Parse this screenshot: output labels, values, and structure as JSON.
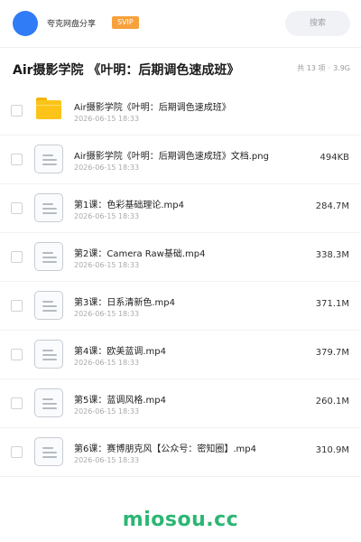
{
  "header": {
    "app_name": "夸克网盘分享",
    "badge": "SVIP",
    "search_label": "搜索"
  },
  "folder": {
    "title": "Air摄影学院 《叶明：后期调色速成班》",
    "count": "共 13 项",
    "sep": "·",
    "size": "3.9G"
  },
  "files": [
    {
      "name": "Air摄影学院《叶明：后期调色速成班》",
      "date": "2026-06-15 18:33",
      "size": "",
      "icon": "folder-icon"
    },
    {
      "name": "Air摄影学院《叶明：后期调色速成班》文档.png",
      "date": "2026-06-15 18:33",
      "size": "494KB",
      "icon": "file-icon"
    },
    {
      "name": "第1课：色彩基础理论.mp4",
      "date": "2026-06-15 18:33",
      "size": "284.7M",
      "icon": "file-icon"
    },
    {
      "name": "第2课：Camera Raw基础.mp4",
      "date": "2026-06-15 18:33",
      "size": "338.3M",
      "icon": "file-icon"
    },
    {
      "name": "第3课：日系清新色.mp4",
      "date": "2026-06-15 18:33",
      "size": "371.1M",
      "icon": "file-icon"
    },
    {
      "name": "第4课：欧美蓝调.mp4",
      "date": "2026-06-15 18:33",
      "size": "379.7M",
      "icon": "file-icon"
    },
    {
      "name": "第5课：蓝调风格.mp4",
      "date": "2026-06-15 18:33",
      "size": "260.1M",
      "icon": "file-icon"
    },
    {
      "name": "第6课：赛博朋克风【公众号：密知圈】.mp4",
      "date": "2026-06-15 18:33",
      "size": "310.9M",
      "icon": "file-icon"
    }
  ],
  "watermark": "miosou.cc",
  "colors": {
    "avatar": "#2f7cf6",
    "badge": "#f7a13b",
    "folder": "#fcc419",
    "watermark": "#2bb673"
  }
}
